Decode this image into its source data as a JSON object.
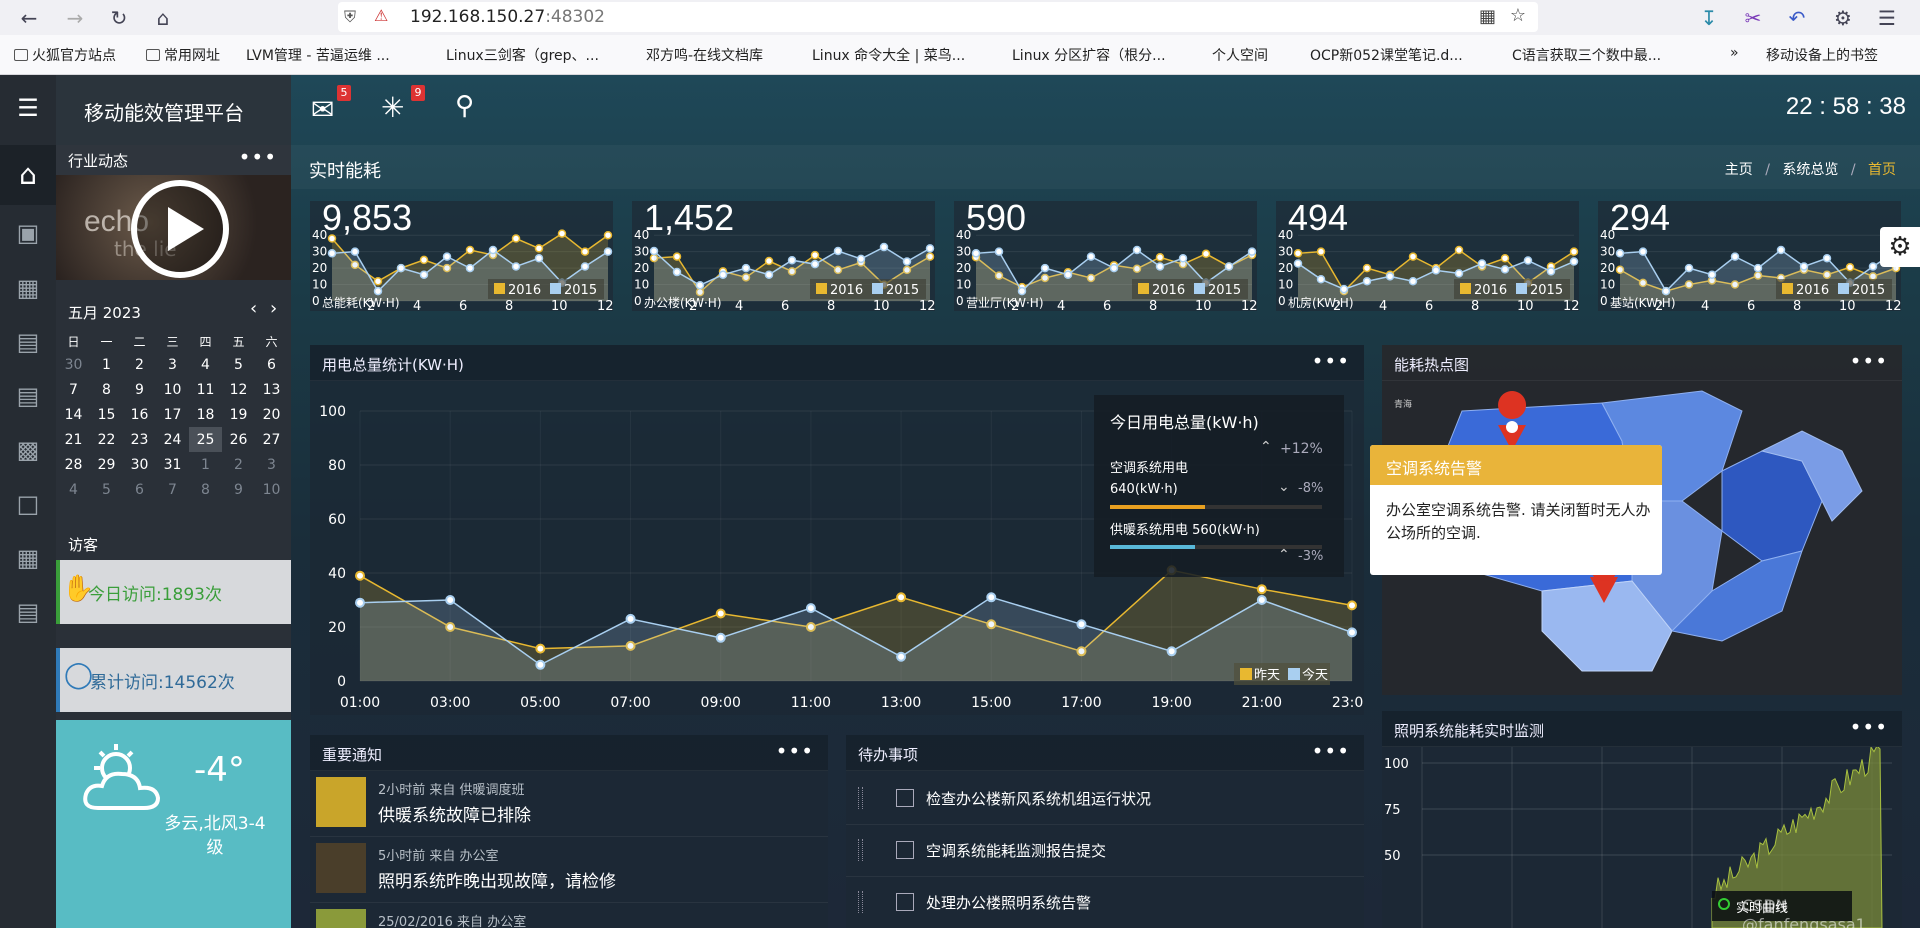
{
  "browser": {
    "url_host": "192.168.150.27",
    "url_port": ":48302",
    "bookmarks": [
      "火狐官方站点",
      "常用网址",
      "LVM管理 - 苦逼运维 ...",
      "Linux三剑客（grep、...",
      "邓方鸣-在线文档库",
      "Linux 命令大全 | 菜鸟...",
      "Linux 分区扩容（根分...",
      "个人空间",
      "OCP新052课堂笔记.d...",
      "C语言获取三个数中最...",
      "移动设备上的书签"
    ]
  },
  "app": {
    "title": "移动能效管理平台",
    "mail_badge": "5",
    "alert_badge": "9",
    "clock": "22 : 58 : 38",
    "page_title": "实时能耗",
    "breadcrumb": [
      "主页",
      "系统总览",
      "首页"
    ]
  },
  "sidebar": {
    "industry_title": "行业动态",
    "video_text1": "echo",
    "video_text2": "the lie",
    "calendar": {
      "month_label": "五月 2023",
      "weekdays": [
        "日",
        "一",
        "二",
        "三",
        "四",
        "五",
        "六"
      ],
      "weeks": [
        [
          "30",
          "1",
          "2",
          "3",
          "4",
          "5",
          "6"
        ],
        [
          "7",
          "8",
          "9",
          "10",
          "11",
          "12",
          "13"
        ],
        [
          "14",
          "15",
          "16",
          "17",
          "18",
          "19",
          "20"
        ],
        [
          "21",
          "22",
          "23",
          "24",
          "25",
          "26",
          "27"
        ],
        [
          "28",
          "29",
          "30",
          "31",
          "1",
          "2",
          "3"
        ],
        [
          "4",
          "5",
          "6",
          "7",
          "8",
          "9",
          "10"
        ]
      ]
    },
    "visitors_title": "访客",
    "today_visits": "今日访问:1893次",
    "total_visits": "累计访问:14562次",
    "weather": {
      "temp": "-4°",
      "desc": "多云,北风3-4级"
    }
  },
  "kpis": [
    {
      "value": "9,853",
      "label": "总能耗(KW·H)"
    },
    {
      "value": "1,452",
      "label": "办公楼(KW·H)"
    },
    {
      "value": "590",
      "label": "营业厅(KW·H)"
    },
    {
      "value": "494",
      "label": "机房(KW·H)"
    },
    {
      "value": "294",
      "label": "基站(KW·H)"
    }
  ],
  "kpi_legend": [
    "2016",
    "2015"
  ],
  "kpi_yticks": [
    "40",
    "30",
    "20",
    "10",
    "0"
  ],
  "kpi_xticks": [
    "2",
    "4",
    "6",
    "8",
    "10",
    "12"
  ],
  "kpi_colors": {
    "s2016": "#e8b830",
    "s2015": "#a9cff0"
  },
  "main_chart_panel": {
    "title": "用电总量统计(KW·H)"
  },
  "chart_data": {
    "type": "area",
    "title": "用电总量统计(KW·H)",
    "x": [
      "01:00",
      "02:00",
      "03:00",
      "04:00",
      "05:00",
      "06:00",
      "07:00",
      "08:00",
      "09:00",
      "10:00",
      "11:00",
      "12:00",
      "13:00",
      "14:00",
      "15:00",
      "16:00",
      "17:00",
      "18:00",
      "19:00",
      "20:00",
      "21:00",
      "22:00",
      "23:00"
    ],
    "xticks": [
      "01:00",
      "03:00",
      "05:00",
      "07:00",
      "09:00",
      "11:00",
      "13:00",
      "15:00",
      "17:00",
      "19:00",
      "21:00",
      "23:00"
    ],
    "yticks": [
      "100",
      "80",
      "60",
      "40",
      "20",
      "0"
    ],
    "ylim": [
      0,
      100
    ],
    "series": [
      {
        "name": "昨天",
        "color": "#e8b830",
        "values": [
          39,
          null,
          20,
          null,
          12,
          null,
          13,
          null,
          25,
          null,
          20,
          null,
          31,
          null,
          21,
          null,
          11,
          null,
          41,
          null,
          34,
          null,
          28
        ]
      },
      {
        "name": "今天",
        "color": "#a9cff0",
        "values": [
          29,
          null,
          30,
          null,
          6,
          null,
          23,
          null,
          16,
          null,
          27,
          null,
          9,
          null,
          31,
          null,
          21,
          null,
          11,
          null,
          30,
          null,
          18
        ]
      }
    ],
    "legend": "bottom-right"
  },
  "tooltip": {
    "title": "今日用电总量(kW·h)",
    "pct_total": "+12%",
    "ac_label": "空调系统用电",
    "ac_value": "640(kW·h)",
    "ac_pct": "-8%",
    "ac_fill": 0.45,
    "heat_label": "供暖系统用电 560(kW·h)",
    "heat_pct": "-3%",
    "heat_fill": 0.4
  },
  "hotspot": {
    "title": "能耗热点图",
    "popup_title": "空调系统告警",
    "popup_text": "办公室空调系统告警. 请关闭暂时无人办公场所的空调.",
    "map_label": "青海"
  },
  "notices": {
    "title": "重要通知",
    "items": [
      {
        "meta": "2小时前 来自 供暖调度班",
        "text": "供暖系统故障已排除"
      },
      {
        "meta": "5小时前 来自 办公室",
        "text": "照明系统昨晚出现故障，请检修"
      },
      {
        "meta": "25/02/2016 来自 办公室",
        "text": ""
      }
    ]
  },
  "todos": {
    "title": "待办事项",
    "items": [
      "检查办公楼新风系统机组运行状况",
      "空调系统能耗监测报告提交",
      "处理办公楼照明系统告警"
    ]
  },
  "lighting": {
    "title": "照明系统能耗实时监测",
    "yticks": [
      "100",
      "75",
      "50"
    ],
    "legend": "实时曲线"
  },
  "watermark": "CSDN @fanfengsasa1"
}
